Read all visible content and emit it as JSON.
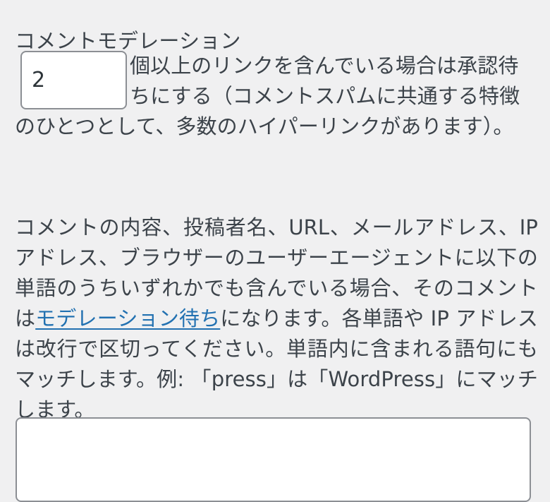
{
  "theme": {
    "background": "#f0f0f1",
    "text_color": "#3c434a",
    "link_color": "#2271b1",
    "field_border": "#8c8f94",
    "field_background": "#ffffff"
  },
  "section": {
    "title": "コメントモデレーション"
  },
  "moderation": {
    "links_threshold_value": "2",
    "links_threshold_placeholder": "",
    "description": "個以上のリンクを含んでいる場合は承認待ちにする（コメントスパムに共通する特徴のひとつとして、多数のハイパーリンクがあります）。"
  },
  "disallowed_keys": {
    "text_before_link": "コメントの内容、投稿者名、URL、メールアドレス、IP アドレス、ブラウザーのユーザーエージェントに以下の単語のうちいずれかでも含んでいる場合、そのコメントは",
    "link_label": "モデレーション待ち",
    "text_after_link": "になります。各単語や IP アドレスは改行で区切ってください。単語内に含まれる語句にもマッチします。例: 「press」は「WordPress」にマッチします。",
    "textarea_value": "",
    "textarea_placeholder": ""
  }
}
